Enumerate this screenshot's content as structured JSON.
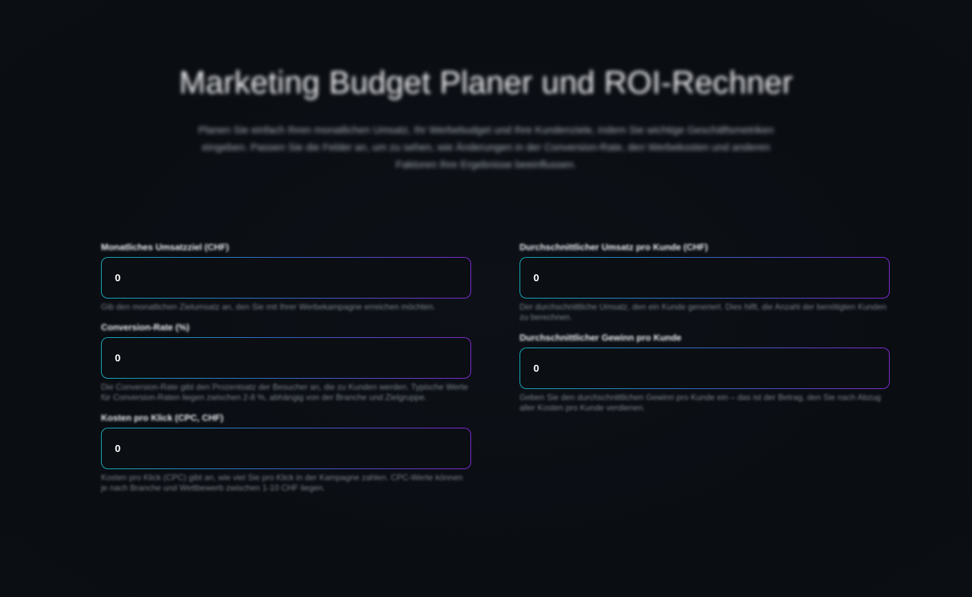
{
  "header": {
    "title": "Marketing Budget Planer und ROI-Rechner",
    "subtitle": "Planen Sie einfach Ihren monatlichen Umsatz, Ihr Werbebudget und Ihre Kundenziele, indem Sie wichtige Geschäftsmetriken eingeben. Passen Sie die Felder an, um zu sehen, wie Änderungen in der Conversion-Rate, den Werbekosten und anderen Faktoren Ihre Ergebnisse beeinflussen."
  },
  "fields": {
    "monthly_revenue": {
      "label": "Monatliches Umsatzziel (CHF)",
      "value": "0",
      "hint": "Gib den monatlichen Zielumsatz an, den Sie mit Ihrer Werbekampagne erreichen möchten."
    },
    "conversion_rate": {
      "label": "Conversion-Rate (%)",
      "value": "0",
      "hint": "Die Conversion-Rate gibt den Prozentsatz der Besucher an, die zu Kunden werden. Typische Werte für Conversion-Raten liegen zwischen 2-8 %, abhängig von der Branche und Zielgruppe."
    },
    "cost_per_click": {
      "label": "Kosten pro Klick (CPC, CHF)",
      "value": "0",
      "hint": "Kosten pro Klick (CPC) gibt an, wie viel Sie pro Klick in der Kampagne zahlen. CPC-Werte können je nach Branche und Wettbewerb zwischen 1-10 CHF liegen."
    },
    "avg_revenue_per_customer": {
      "label": "Durchschnittlicher Umsatz pro Kunde (CHF)",
      "value": "0",
      "hint": "Der durchschnittliche Umsatz, den ein Kunde generiert. Dies hilft, die Anzahl der benötigten Kunden zu berechnen."
    },
    "avg_profit_per_customer": {
      "label": "Durchschnittlicher Gewinn pro Kunde",
      "value": "0",
      "hint": "Geben Sie den durchschnittlichen Gewinn pro Kunde ein – das ist der Betrag, den Sie nach Abzug aller Kosten pro Kunde verdienen."
    }
  },
  "colors": {
    "background": "#0b0e13",
    "border_gradient_start": "#15b8c8",
    "border_gradient_end": "#8a2be2"
  }
}
